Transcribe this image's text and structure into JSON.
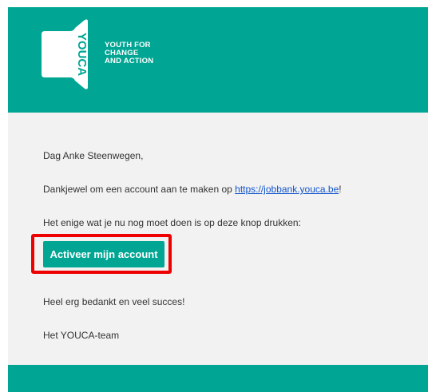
{
  "header": {
    "logo_text": "YOUCA",
    "tagline": [
      "YOUTH FOR",
      "CHANGE",
      "AND ACTION"
    ]
  },
  "message": {
    "greeting": "Dag Anke Steenwegen,",
    "thanks_prefix": "Dankjewel om een account aan te maken op ",
    "link_text": "https://jobbank.youca.be",
    "thanks_suffix": "!",
    "instruction": "Het enige wat je nu nog moet doen is op deze knop drukken:",
    "button_label": "Activeer mijn account",
    "closing": "Heel erg bedankt en veel succes!",
    "signature": "Het YOUCA-team"
  },
  "colors": {
    "brand": "#00a693",
    "highlight": "#ee0000",
    "link": "#1155cc"
  }
}
